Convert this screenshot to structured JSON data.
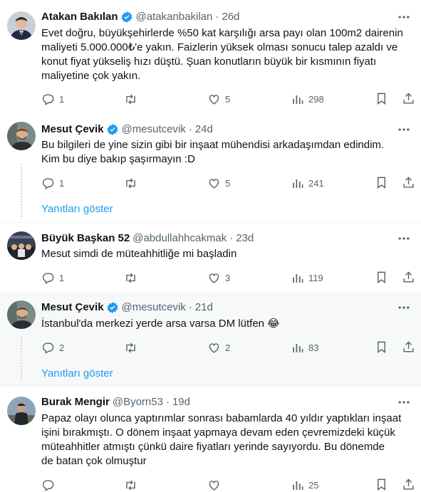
{
  "tweets": [
    {
      "name": "Atakan Bakılan",
      "handle": "@atakanbakilan",
      "time": "26d",
      "text": "Evet doğru, büyükşehirlerde %50 kat karşılığı arsa payı olan 100m2 dairenin\nmaliyeti 5.000.000₺'e yakın. Faizlerin yüksek olması sonucu talep azaldı ve\nkonut fiyat yükseliş hızı düştü. Şuan konutların büyük bir kısmının fiyatı\nmaliyetine çok yakın.",
      "replies": "1",
      "reposts": "",
      "likes": "5",
      "views": "298"
    },
    {
      "name": "Mesut Çevik",
      "handle": "@mesutcevik",
      "time": "24d",
      "text": "Bu bilgileri de yine sizin gibi bir inşaat mühendisi arkadaşımdan edindim.\nKim bu diye bakıp şaşırmayın :D",
      "replies": "1",
      "reposts": "",
      "likes": "5",
      "views": "241"
    },
    {
      "name": "Büyük Başkan 52",
      "handle": "@abdullahhcakmak",
      "time": "23d",
      "text": "Mesut simdi de müteahhitliğe mi başladin",
      "replies": "1",
      "reposts": "",
      "likes": "3",
      "views": "119"
    },
    {
      "name": "Mesut Çevik",
      "handle": "@mesutcevik",
      "time": "21d",
      "text": "İstanbul'da merkezi yerde arsa varsa DM lütfen 😂",
      "replies": "2",
      "reposts": "",
      "likes": "2",
      "views": "83"
    },
    {
      "name": "Burak Mengir",
      "handle": "@Byorn53",
      "time": "19d",
      "text": "Papaz olayı olunca yaptırımlar sonrası babamlarda 40 yıldır yaptıkları inşaat\nişini bırakmıştı. O dönem inşaat yapmaya devam eden çevremizdeki küçük\nmüteahhitler atmıştı çünkü daire fiyatları yerinde sayıyordu. Bu dönemde\nde batan çok olmuştur",
      "replies": "",
      "reposts": "",
      "likes": "",
      "views": "25"
    }
  ],
  "show_replies_label": "Yanıtları göster",
  "separator": "·",
  "colors": {
    "accent": "#1d9bf0",
    "verified": "#1d9bf0",
    "muted": "#536471",
    "highlight_bg": "#f7f9f9"
  },
  "icons": [
    "verified-badge-icon",
    "more-icon",
    "reply-icon",
    "repost-icon",
    "like-icon",
    "views-icon",
    "bookmark-icon",
    "share-icon"
  ]
}
